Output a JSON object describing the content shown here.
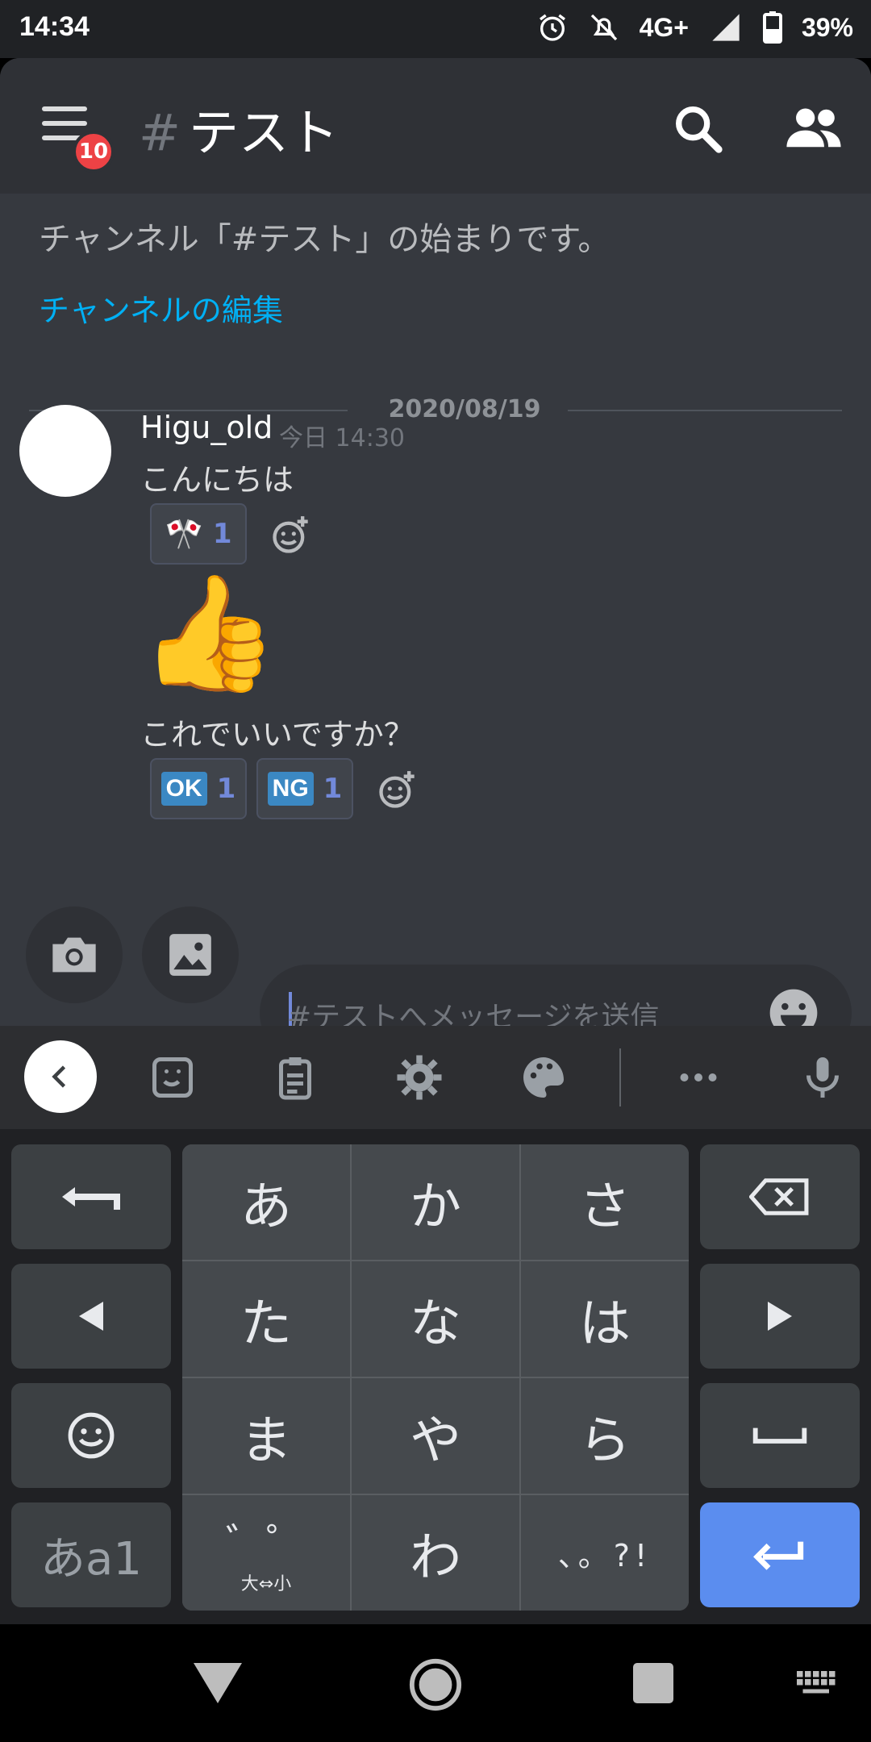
{
  "status_bar": {
    "time": "14:34",
    "network": "4G+",
    "battery": "39%"
  },
  "header": {
    "channel_hash": "#",
    "channel_name": "テスト",
    "notification_count": "10"
  },
  "channel_intro": {
    "start_text": "チャンネル「#テスト」の始まりです。",
    "edit_link": "チャンネルの編集"
  },
  "divider_date": "2020/08/19",
  "message": {
    "author": "Higu_old",
    "timestamp": "今日 14:30",
    "lines": [
      {
        "text": "こんにちは",
        "reactions": [
          {
            "emoji": "🎌",
            "count": "1"
          }
        ]
      },
      {
        "emoji": "👍"
      },
      {
        "text": "これでいいですか？",
        "reactions": [
          {
            "emoji": "OK",
            "count": "1"
          },
          {
            "emoji": "NG",
            "count": "1"
          }
        ]
      }
    ]
  },
  "composer": {
    "placeholder": "#テストへメッセージを送信"
  },
  "keyboard": {
    "grid": [
      [
        "あ",
        "か",
        "さ"
      ],
      [
        "た",
        "な",
        "は"
      ],
      [
        "ま",
        "や",
        "ら"
      ],
      [
        "゛゜",
        "わ",
        "、。?!"
      ]
    ],
    "mode_label": "あa1",
    "case_hint": "大⇔小"
  },
  "colors": {
    "accent": "#5b8def",
    "link": "#00b0f4",
    "badge": "#ed4245"
  }
}
